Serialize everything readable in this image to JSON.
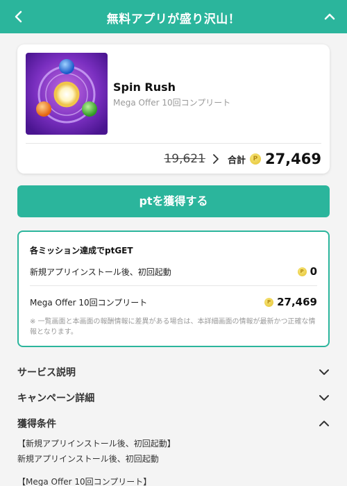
{
  "header": {
    "title": "無料アプリが盛り沢山！",
    "bg_color": "#2bb59c",
    "back_icon": "chevron-left-icon",
    "collapse_icon": "chevron-up-icon"
  },
  "offer": {
    "app_name": "Spin Rush",
    "subtitle": "Mega Offer 10回コンプリート",
    "old_price": "19,621",
    "total_label": "合計",
    "coin_glyph": "P",
    "total_price": "27,469"
  },
  "cta": {
    "label": "ptを獲得する"
  },
  "missions": {
    "title": "各ミッション達成でptGET",
    "items": [
      {
        "label": "新規アプリインストール後、初回起動",
        "value": "0"
      },
      {
        "label": "Mega Offer 10回コンプリート",
        "value": "27,469"
      }
    ],
    "note": "※ 一覧画面と本画面の報酬情報に差異がある場合は、本詳細画面の情報が最新かつ正確な情報となります。"
  },
  "sections": [
    {
      "label": "サービス説明",
      "state": "collapsed"
    },
    {
      "label": "キャンペーン詳細",
      "state": "collapsed"
    },
    {
      "label": "獲得条件",
      "state": "expanded"
    }
  ],
  "conditions": [
    "【新規アプリインストール後、初回起動】",
    "新規アプリインストール後、初回起動",
    "【Mega Offer 10回コンプリート】"
  ]
}
